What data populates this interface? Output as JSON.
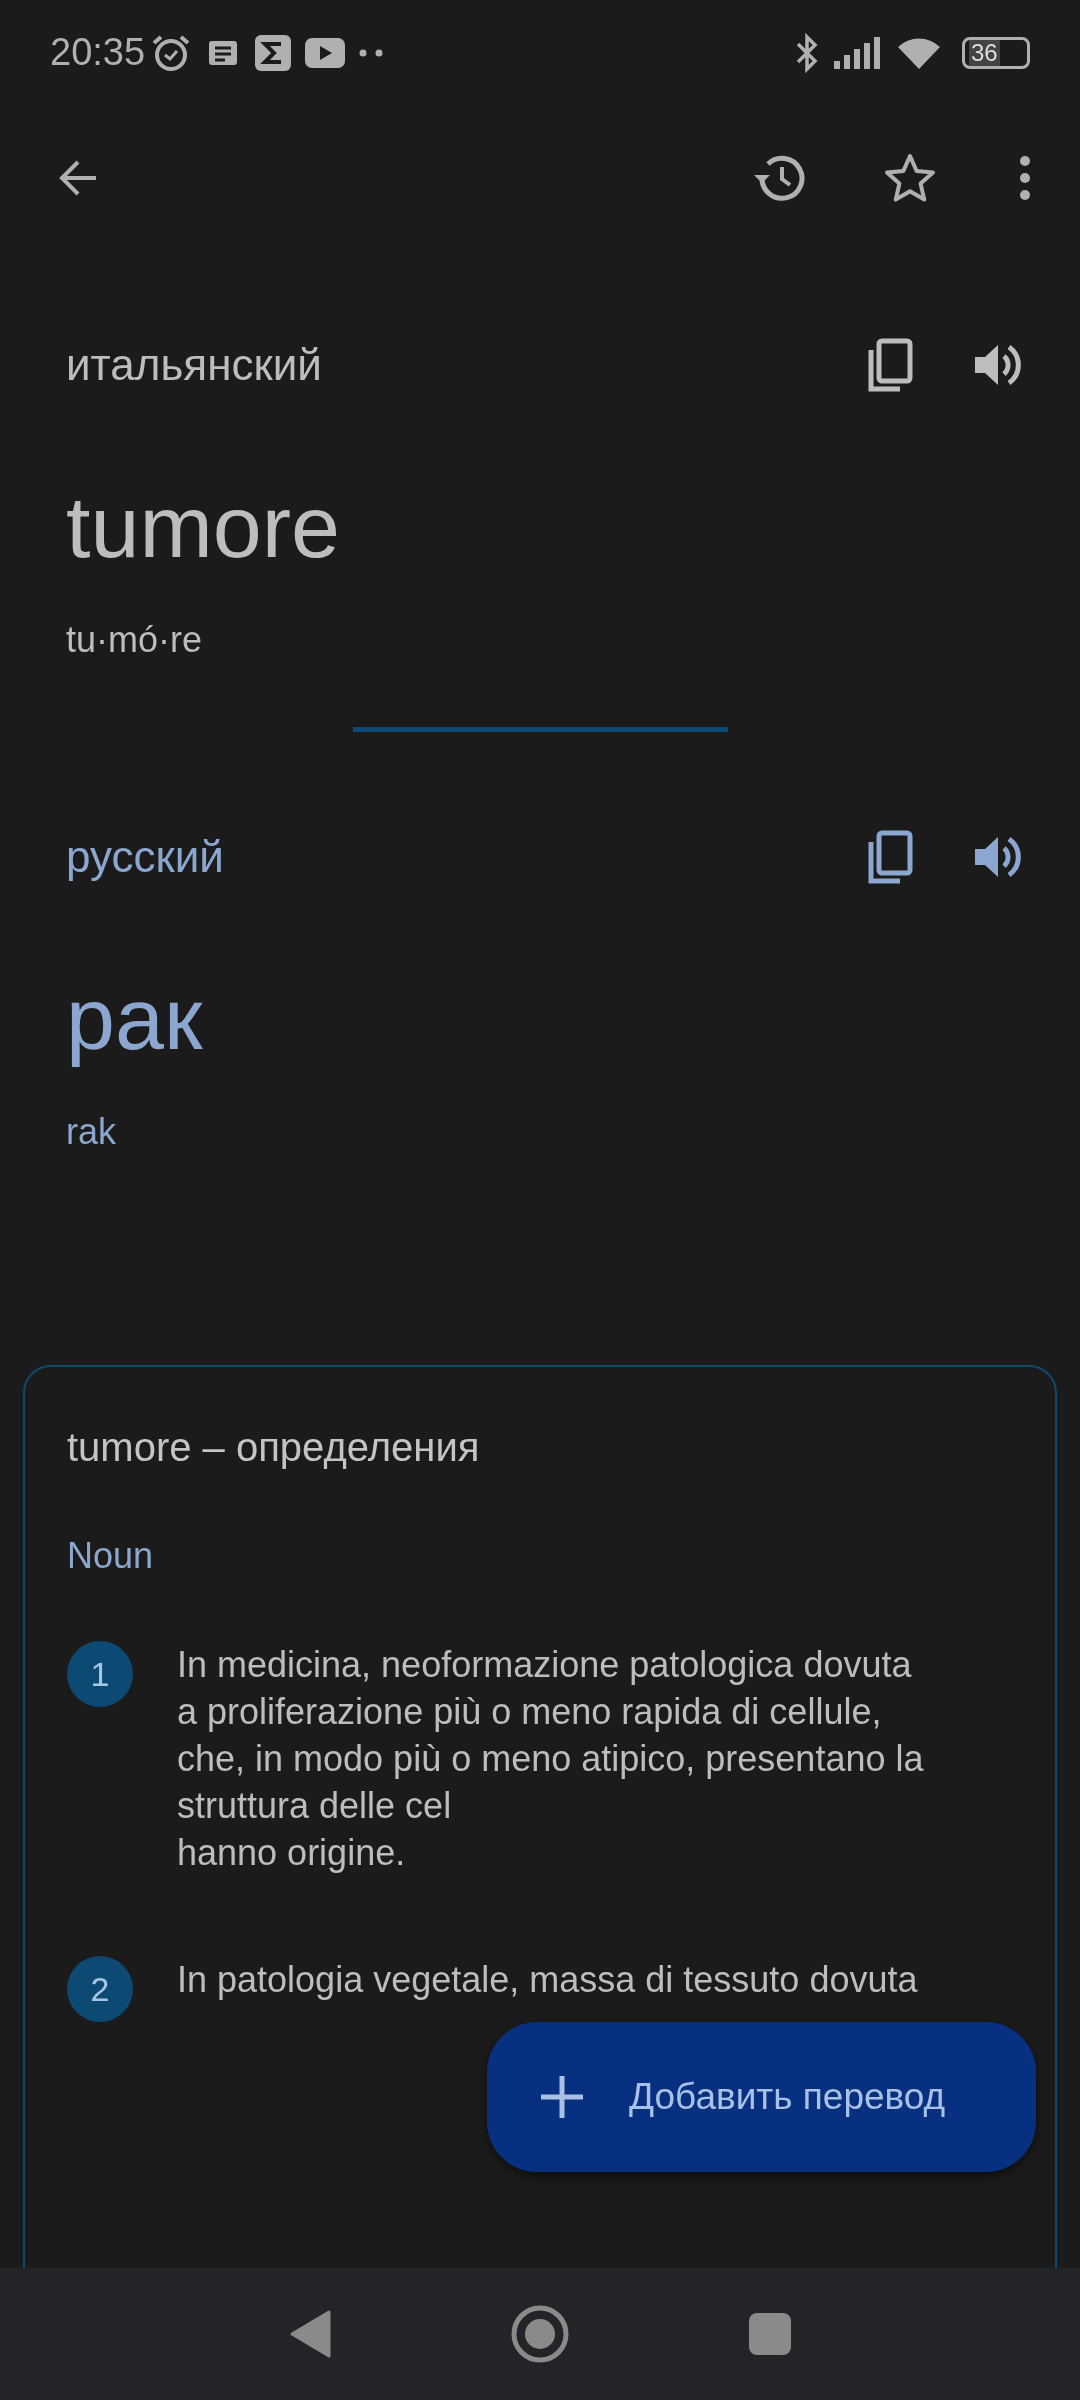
{
  "status_bar": {
    "time": "20:35",
    "battery": "36"
  },
  "source": {
    "language": "итальянский",
    "word": "tumore",
    "syllables": "tu·mó·re"
  },
  "target": {
    "language": "русский",
    "word": "рак",
    "transliteration": "rak"
  },
  "definitions": {
    "title": "tumore – определения",
    "part_of_speech": "Noun",
    "items": [
      {
        "number": "1",
        "lines": [
          "In medicina, neoformazione patologica dovuta",
          "a proliferazione più o meno rapida di cellule,",
          "che, in modo più o meno atipico, presentano la",
          "struttura delle cel",
          "hanno origine."
        ]
      },
      {
        "number": "2",
        "lines": [
          "In patologia vegetale, massa di tessuto dovuta"
        ]
      }
    ]
  },
  "fab": {
    "label": "Добавить перевод"
  }
}
